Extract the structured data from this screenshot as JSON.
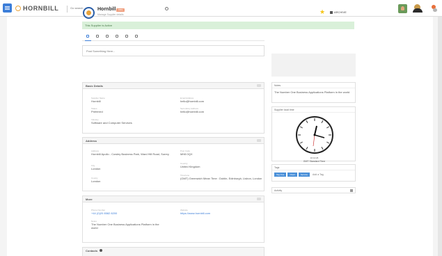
{
  "topbar": {
    "logo_text": "HORNBILL",
    "search_placeholder": "Go search ..."
  },
  "header": {
    "org_name": "Hornbill",
    "org_badge": "ORG",
    "org_subtitle": "Manage Supplier details",
    "archive_label": "ARCHIVE"
  },
  "alert": {
    "text": "This Supplier is Active"
  },
  "post": {
    "placeholder": "Post Something Here..."
  },
  "basic_details": {
    "title": "Basic Details",
    "fields": [
      {
        "label": "Supplier Name",
        "value": "Hornbill"
      },
      {
        "label": "Email Address",
        "value": "hello@hornbill.com"
      },
      {
        "label": "Status",
        "value": "Preferred"
      },
      {
        "label": "Secondary Address",
        "value": "hello@hornbill.com"
      },
      {
        "label": "Industry",
        "value": "Software and Computer Services"
      }
    ]
  },
  "address": {
    "title": "Address",
    "fields": [
      {
        "label": "Address",
        "value": "Hornbill Apollo - Cowley Business Park, Ward Hill Road, Surrey"
      },
      {
        "label": "Post Code",
        "value": "MH8 0QX"
      },
      {
        "label": "City",
        "value": "London"
      },
      {
        "label": "Country",
        "value": "United Kingdom"
      },
      {
        "label": "County",
        "value": "London"
      },
      {
        "label": "Timezone",
        "value": "(GMT) Greenwich Mean Time : Dublin, Edinburgh, Lisbon, London"
      }
    ]
  },
  "more": {
    "title": "More",
    "fields": [
      {
        "label": "Phone Number",
        "value": "+44 (0)20 8582 8200"
      },
      {
        "label": "Website",
        "value": "https://www.hornbill.com"
      },
      {
        "label": "Notes",
        "value": "The Number One Business Applications Platform in the world"
      }
    ]
  },
  "contacts": {
    "title": "Contacts"
  },
  "right": {
    "notes_title": "Notes",
    "notes_text": "The Number One Business Applications Platform in the world",
    "local_time_title": "Supplier local time",
    "clock_time": "10:14:26",
    "clock_zone": "GMT Standard Time",
    "tags_title": "Tags",
    "tags": [
      "Tag One",
      "Client",
      "Service"
    ],
    "add_tag": "Add a Tag",
    "activity_title": "Activity"
  },
  "colors": {
    "accent": "#3b7dd8",
    "alert_bg": "#d9f0d9",
    "star": "#f5c518"
  }
}
